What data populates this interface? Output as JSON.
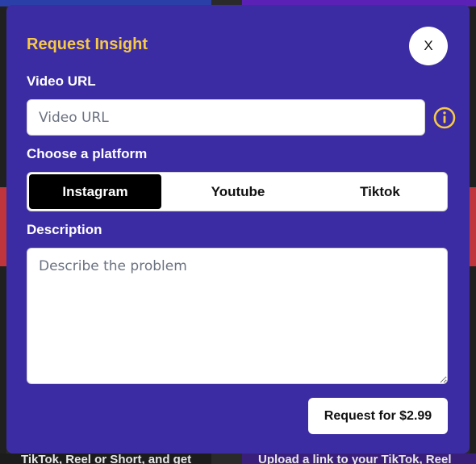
{
  "modal": {
    "title": "Request Insight",
    "close_label": "X",
    "video_url": {
      "label": "Video URL",
      "placeholder": "Video URL",
      "value": ""
    },
    "info_icon": "info-circle-icon",
    "platform": {
      "label": "Choose a platform",
      "options": [
        "Instagram",
        "Youtube",
        "Tiktok"
      ],
      "selected": "Instagram"
    },
    "description": {
      "label": "Description",
      "placeholder": "Describe the problem",
      "value": ""
    },
    "submit_label": "Request for $2.99"
  },
  "background": {
    "bottom_left_text": "TikTok, Reel or Short, and get",
    "bottom_right_text": "Upload a link to your TikTok, Reel"
  },
  "colors": {
    "modal_bg": "#3b2ca3",
    "title": "#f7c948",
    "accent_icon": "#f7c948",
    "selected_platform_bg": "#000000"
  }
}
